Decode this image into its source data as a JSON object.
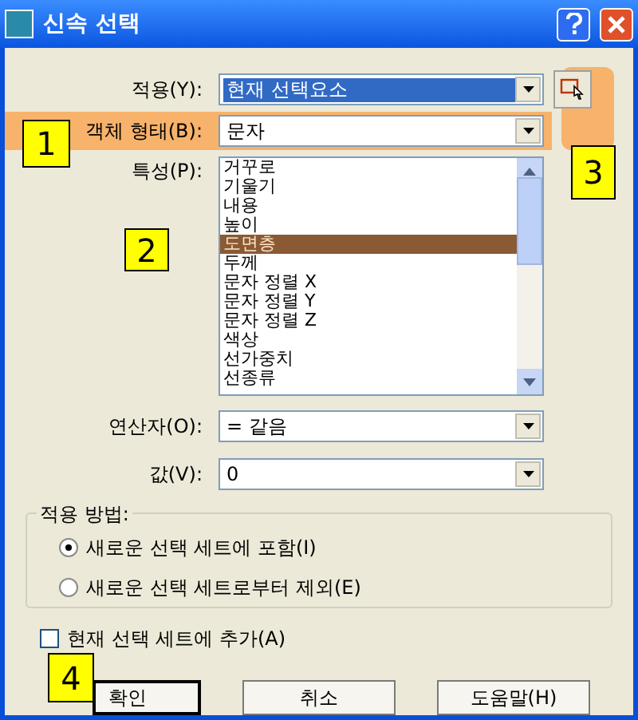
{
  "window": {
    "title": "신속 선택"
  },
  "apply_to": {
    "label": "적용(Y):",
    "value": "현재 선택요소",
    "focused": true
  },
  "object_type": {
    "label": "객체 형태(B):",
    "value": "문자",
    "highlighted": true
  },
  "properties": {
    "label": "특성(P):",
    "items": [
      {
        "text": "거꾸로",
        "selected": false
      },
      {
        "text": "기울기",
        "selected": false
      },
      {
        "text": "내용",
        "selected": false
      },
      {
        "text": "높이",
        "selected": false
      },
      {
        "text": "도면층",
        "selected": true
      },
      {
        "text": "두께",
        "selected": false
      },
      {
        "text": "문자 정렬 X",
        "selected": false
      },
      {
        "text": "문자 정렬 Y",
        "selected": false
      },
      {
        "text": "문자 정렬 Z",
        "selected": false
      },
      {
        "text": "색상",
        "selected": false
      },
      {
        "text": "선가중치",
        "selected": false
      },
      {
        "text": "선종류",
        "selected": false
      }
    ]
  },
  "operator": {
    "label": "연산자(O):",
    "value": "= 같음"
  },
  "value": {
    "label": "값(V):",
    "value": "0"
  },
  "apply_method": {
    "title": "적용 방법:",
    "options": [
      {
        "label": "새로운 선택 세트에 포함(I)",
        "selected": true
      },
      {
        "label": "새로운 선택 세트로부터 제외(E)",
        "selected": false
      }
    ]
  },
  "append": {
    "label": "현재 선택 세트에 추가(A)",
    "checked": false
  },
  "buttons": [
    {
      "label": "확인",
      "default": true
    },
    {
      "label": "취소",
      "default": false
    },
    {
      "label": "도움말(H)",
      "default": false
    }
  ],
  "callouts": [
    {
      "label": "1"
    },
    {
      "label": "2"
    },
    {
      "label": "3"
    },
    {
      "label": "4"
    }
  ]
}
